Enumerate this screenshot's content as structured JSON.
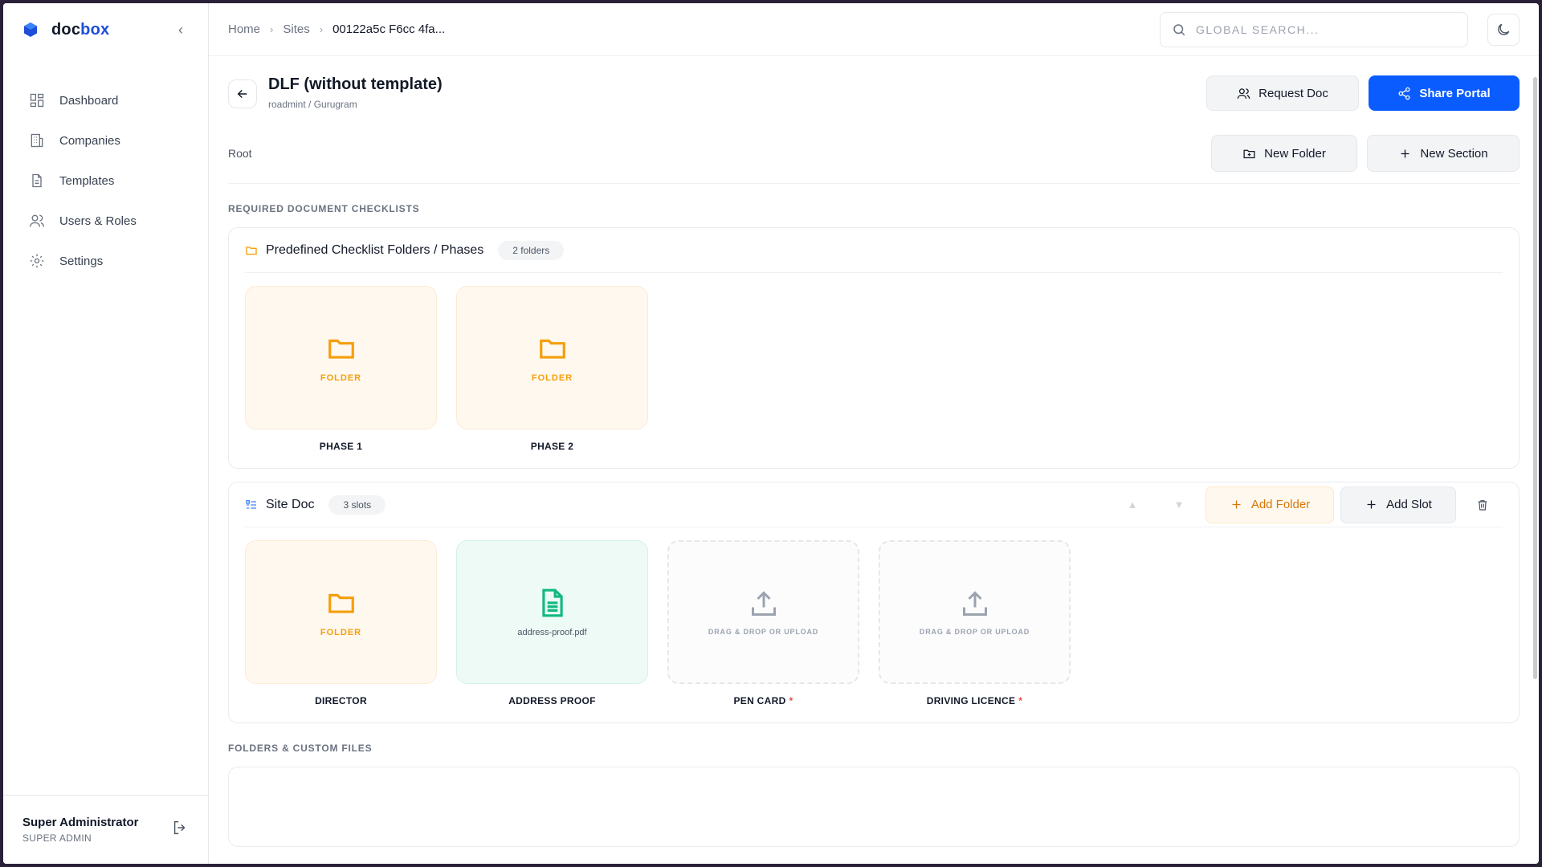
{
  "app": {
    "name_part1": "doc",
    "name_part2": "box"
  },
  "sidebar": {
    "items": [
      {
        "label": "Dashboard",
        "icon": "grid-icon"
      },
      {
        "label": "Companies",
        "icon": "building-icon"
      },
      {
        "label": "Templates",
        "icon": "document-icon"
      },
      {
        "label": "Users & Roles",
        "icon": "users-icon"
      },
      {
        "label": "Settings",
        "icon": "gear-icon"
      }
    ],
    "user": {
      "name": "Super Administrator",
      "role": "SUPER ADMIN"
    }
  },
  "breadcrumb": {
    "home": "Home",
    "sites": "Sites",
    "current": "00122a5c F6cc 4fa..."
  },
  "search": {
    "placeholder": "GLOBAL SEARCH..."
  },
  "page": {
    "title": "DLF (without template)",
    "subtitle": "roadmint / Gurugram",
    "request_label": "Request Doc",
    "share_label": "Share Portal",
    "root_label": "Root",
    "new_folder_label": "New Folder",
    "new_section_label": "New Section"
  },
  "checklists": {
    "heading": "REQUIRED DOCUMENT CHECKLISTS",
    "predefined": {
      "title": "Predefined Checklist Folders / Phases",
      "count": "2 folders",
      "tiles": [
        {
          "caption": "FOLDER",
          "label": "PHASE 1"
        },
        {
          "caption": "FOLDER",
          "label": "PHASE 2"
        }
      ]
    },
    "sitedoc": {
      "title": "Site Doc",
      "count": "3 slots",
      "add_folder_label": "Add Folder",
      "add_slot_label": "Add Slot",
      "tiles": [
        {
          "caption": "FOLDER",
          "label": "DIRECTOR"
        },
        {
          "caption": "address-proof.pdf",
          "label": "ADDRESS PROOF"
        },
        {
          "caption": "DRAG & DROP OR UPLOAD",
          "label": "PEN CARD",
          "required": "*"
        },
        {
          "caption": "DRAG & DROP OR UPLOAD",
          "label": "DRIVING LICENCE",
          "required": "*"
        }
      ]
    }
  },
  "custom": {
    "heading": "FOLDERS & CUSTOM FILES"
  },
  "colors": {
    "accent": "#0b5cff",
    "folder": "#f59e0b",
    "file": "#10b981",
    "required": "#ef4444"
  }
}
